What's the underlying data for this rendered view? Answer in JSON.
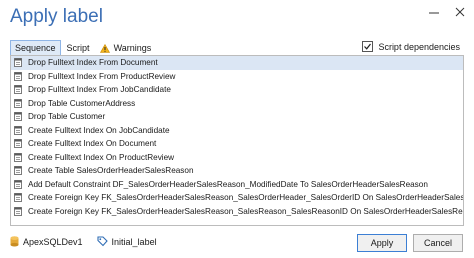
{
  "window": {
    "title": "Apply label"
  },
  "tabs": [
    {
      "label": "Sequence",
      "active": true
    },
    {
      "label": "Script",
      "active": false
    },
    {
      "label": "Warnings",
      "active": false,
      "icon": "warning-icon"
    }
  ],
  "script_dependencies": {
    "label": "Script dependencies",
    "checked": true
  },
  "sequence_items": [
    "Drop Fulltext Index  From Document",
    "Drop Fulltext Index  From ProductReview",
    "Drop Fulltext Index  From JobCandidate",
    "Drop Table CustomerAddress",
    "Drop Table Customer",
    "Create Fulltext Index  On JobCandidate",
    "Create Fulltext Index  On Document",
    "Create Fulltext Index  On ProductReview",
    "Create Table SalesOrderHeaderSalesReason",
    "Add Default Constraint DF_SalesOrderHeaderSalesReason_ModifiedDate To SalesOrderHeaderSalesReason",
    "Create Foreign Key FK_SalesOrderHeaderSalesReason_SalesOrderHeader_SalesOrderID On SalesOrderHeaderSalesReason",
    "Create Foreign Key FK_SalesOrderHeaderSalesReason_SalesReason_SalesReasonID On SalesOrderHeaderSalesReason"
  ],
  "status": {
    "database": "ApexSQLDev1",
    "label": "Initial_label"
  },
  "buttons": {
    "apply": "Apply",
    "cancel": "Cancel"
  },
  "colors": {
    "title": "#3c6fb5",
    "selection": "#dbe6f4",
    "accent_border": "#3c7fd4"
  }
}
